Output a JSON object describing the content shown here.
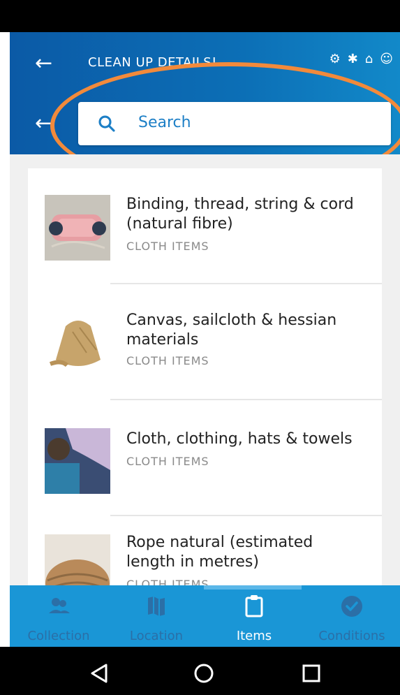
{
  "header": {
    "title": "CLEAN UP DETAILS!",
    "search_placeholder": "Search"
  },
  "items": [
    {
      "title_line1": "Binding, thread, string & cord",
      "title_line2": "(natural fibre)",
      "category": "CLOTH ITEMS"
    },
    {
      "title_line1": "Canvas, sailcloth & hessian",
      "title_line2": "materials",
      "category": "CLOTH ITEMS"
    },
    {
      "title_line1": "Cloth, clothing, hats & towels",
      "title_line2": "",
      "category": "CLOTH ITEMS"
    },
    {
      "title_line1": "Rope natural (estimated",
      "title_line2": "length in metres)",
      "category": "CLOTH ITEMS"
    }
  ],
  "tabs": [
    {
      "label": "Collection",
      "icon": "people-icon"
    },
    {
      "label": "Location",
      "icon": "map-icon"
    },
    {
      "label": "Items",
      "icon": "clipboard-icon"
    },
    {
      "label": "Conditions",
      "icon": "check-circle-icon"
    }
  ],
  "colors": {
    "header_blue": "#0c6fb6",
    "tab_blue": "#1a96d6",
    "highlight_orange": "#f28a3b",
    "search_accent": "#1d7fc6"
  }
}
